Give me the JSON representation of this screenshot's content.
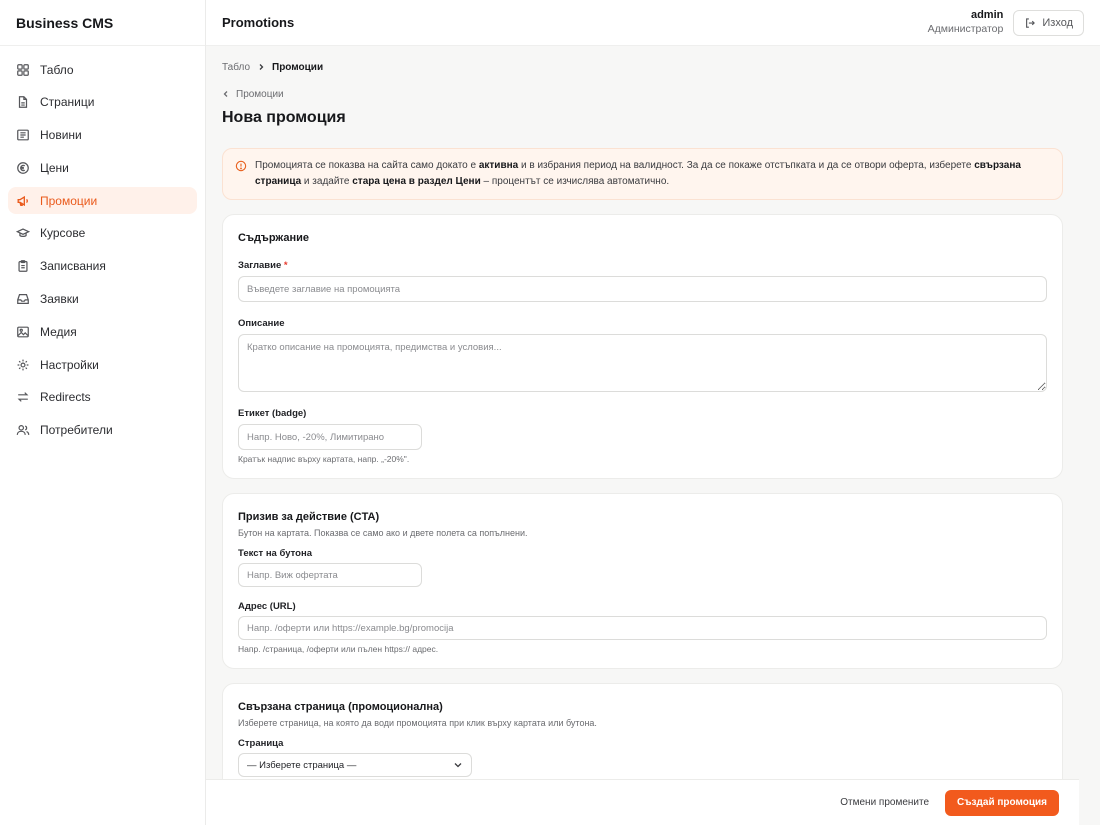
{
  "app": {
    "brand": "Business CMS"
  },
  "sidebar": {
    "items": [
      {
        "label": "Табло",
        "icon": "grid-icon"
      },
      {
        "label": "Страници",
        "icon": "file-icon"
      },
      {
        "label": "Новини",
        "icon": "newspaper-icon"
      },
      {
        "label": "Цени",
        "icon": "euro-icon"
      },
      {
        "label": "Промоции",
        "icon": "megaphone-icon",
        "active": true
      },
      {
        "label": "Курсове",
        "icon": "graduation-cap-icon"
      },
      {
        "label": "Записвания",
        "icon": "clipboard-icon"
      },
      {
        "label": "Заявки",
        "icon": "inbox-icon"
      },
      {
        "label": "Медия",
        "icon": "image-icon"
      },
      {
        "label": "Настройки",
        "icon": "gear-icon"
      },
      {
        "label": "Redirects",
        "icon": "swap-icon"
      },
      {
        "label": "Потребители",
        "icon": "users-icon"
      }
    ]
  },
  "header": {
    "title": "Promotions",
    "user_name": "admin",
    "user_role": "Администратор",
    "logout_label": "Изход"
  },
  "breadcrumb": {
    "root": "Табло",
    "current": "Промоции"
  },
  "back_link": "Промоции",
  "page_title": "Нова промоция",
  "alert": {
    "t1": "Промоцията се показва на сайта само докато е ",
    "b1": "активна",
    "t2": " и в избрания период на валидност. За да се покаже отстъпката и да се отвори оферта, изберете ",
    "b2": "свързана страница",
    "t3": " и задайте ",
    "b3": "стара цена в раздел Цени",
    "t4": " – процентът се изчислява автоматично."
  },
  "content_card": {
    "title": "Съдържание",
    "title_label": "Заглавие",
    "required_mark": "*",
    "title_placeholder": "Въведете заглавие на промоцията",
    "description_label": "Описание",
    "description_placeholder": "Кратко описание на промоцията, предимства и условия...",
    "badge_label": "Етикет (badge)",
    "badge_placeholder": "Напр. Ново, -20%, Лимитирано",
    "badge_hint": "Кратък надпис върху картата, напр. „-20%\"."
  },
  "cta_card": {
    "title": "Призив за действие (CTA)",
    "description": "Бутон на картата. Показва се само ако и двете полета са попълнени.",
    "button_text_label": "Текст на бутона",
    "button_text_placeholder": "Напр. Виж офертата",
    "url_label": "Адрес (URL)",
    "url_placeholder": "Напр. /оферти или https://example.bg/promocija",
    "url_hint": "Напр. /страница, /оферти или пълен https:// адрес."
  },
  "page_card": {
    "title": "Свързана страница (промоционална)",
    "description": "Изберете страница, на която да води промоцията при клик върху картата или бутона.",
    "page_label": "Страница",
    "page_selected": "— Изберете страница —"
  },
  "footer": {
    "discard_label": "Отмени промените",
    "create_label": "Създай промоция"
  },
  "colors": {
    "accent": "#f25a1d",
    "active_bg": "#fff1ea",
    "alert_bg": "#fff5ee"
  }
}
